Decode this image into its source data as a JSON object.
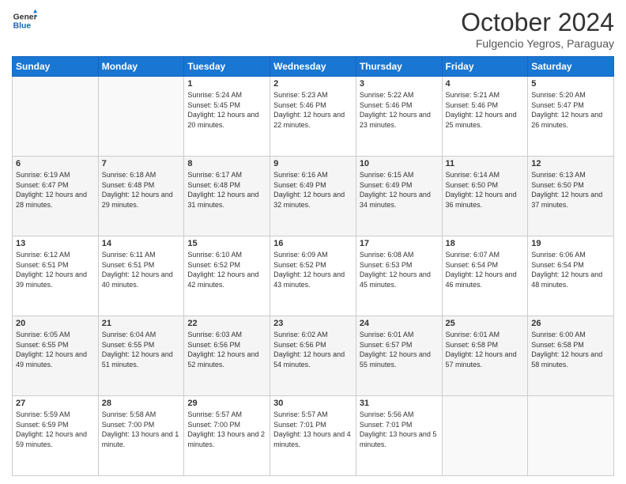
{
  "header": {
    "logo_line1": "General",
    "logo_line2": "Blue",
    "month_title": "October 2024",
    "location": "Fulgencio Yegros, Paraguay"
  },
  "days_of_week": [
    "Sunday",
    "Monday",
    "Tuesday",
    "Wednesday",
    "Thursday",
    "Friday",
    "Saturday"
  ],
  "weeks": [
    [
      {
        "day": "",
        "sunrise": "",
        "sunset": "",
        "daylight": ""
      },
      {
        "day": "",
        "sunrise": "",
        "sunset": "",
        "daylight": ""
      },
      {
        "day": "1",
        "sunrise": "Sunrise: 5:24 AM",
        "sunset": "Sunset: 5:45 PM",
        "daylight": "Daylight: 12 hours and 20 minutes."
      },
      {
        "day": "2",
        "sunrise": "Sunrise: 5:23 AM",
        "sunset": "Sunset: 5:46 PM",
        "daylight": "Daylight: 12 hours and 22 minutes."
      },
      {
        "day": "3",
        "sunrise": "Sunrise: 5:22 AM",
        "sunset": "Sunset: 5:46 PM",
        "daylight": "Daylight: 12 hours and 23 minutes."
      },
      {
        "day": "4",
        "sunrise": "Sunrise: 5:21 AM",
        "sunset": "Sunset: 5:46 PM",
        "daylight": "Daylight: 12 hours and 25 minutes."
      },
      {
        "day": "5",
        "sunrise": "Sunrise: 5:20 AM",
        "sunset": "Sunset: 5:47 PM",
        "daylight": "Daylight: 12 hours and 26 minutes."
      }
    ],
    [
      {
        "day": "6",
        "sunrise": "Sunrise: 6:19 AM",
        "sunset": "Sunset: 6:47 PM",
        "daylight": "Daylight: 12 hours and 28 minutes."
      },
      {
        "day": "7",
        "sunrise": "Sunrise: 6:18 AM",
        "sunset": "Sunset: 6:48 PM",
        "daylight": "Daylight: 12 hours and 29 minutes."
      },
      {
        "day": "8",
        "sunrise": "Sunrise: 6:17 AM",
        "sunset": "Sunset: 6:48 PM",
        "daylight": "Daylight: 12 hours and 31 minutes."
      },
      {
        "day": "9",
        "sunrise": "Sunrise: 6:16 AM",
        "sunset": "Sunset: 6:49 PM",
        "daylight": "Daylight: 12 hours and 32 minutes."
      },
      {
        "day": "10",
        "sunrise": "Sunrise: 6:15 AM",
        "sunset": "Sunset: 6:49 PM",
        "daylight": "Daylight: 12 hours and 34 minutes."
      },
      {
        "day": "11",
        "sunrise": "Sunrise: 6:14 AM",
        "sunset": "Sunset: 6:50 PM",
        "daylight": "Daylight: 12 hours and 36 minutes."
      },
      {
        "day": "12",
        "sunrise": "Sunrise: 6:13 AM",
        "sunset": "Sunset: 6:50 PM",
        "daylight": "Daylight: 12 hours and 37 minutes."
      }
    ],
    [
      {
        "day": "13",
        "sunrise": "Sunrise: 6:12 AM",
        "sunset": "Sunset: 6:51 PM",
        "daylight": "Daylight: 12 hours and 39 minutes."
      },
      {
        "day": "14",
        "sunrise": "Sunrise: 6:11 AM",
        "sunset": "Sunset: 6:51 PM",
        "daylight": "Daylight: 12 hours and 40 minutes."
      },
      {
        "day": "15",
        "sunrise": "Sunrise: 6:10 AM",
        "sunset": "Sunset: 6:52 PM",
        "daylight": "Daylight: 12 hours and 42 minutes."
      },
      {
        "day": "16",
        "sunrise": "Sunrise: 6:09 AM",
        "sunset": "Sunset: 6:52 PM",
        "daylight": "Daylight: 12 hours and 43 minutes."
      },
      {
        "day": "17",
        "sunrise": "Sunrise: 6:08 AM",
        "sunset": "Sunset: 6:53 PM",
        "daylight": "Daylight: 12 hours and 45 minutes."
      },
      {
        "day": "18",
        "sunrise": "Sunrise: 6:07 AM",
        "sunset": "Sunset: 6:54 PM",
        "daylight": "Daylight: 12 hours and 46 minutes."
      },
      {
        "day": "19",
        "sunrise": "Sunrise: 6:06 AM",
        "sunset": "Sunset: 6:54 PM",
        "daylight": "Daylight: 12 hours and 48 minutes."
      }
    ],
    [
      {
        "day": "20",
        "sunrise": "Sunrise: 6:05 AM",
        "sunset": "Sunset: 6:55 PM",
        "daylight": "Daylight: 12 hours and 49 minutes."
      },
      {
        "day": "21",
        "sunrise": "Sunrise: 6:04 AM",
        "sunset": "Sunset: 6:55 PM",
        "daylight": "Daylight: 12 hours and 51 minutes."
      },
      {
        "day": "22",
        "sunrise": "Sunrise: 6:03 AM",
        "sunset": "Sunset: 6:56 PM",
        "daylight": "Daylight: 12 hours and 52 minutes."
      },
      {
        "day": "23",
        "sunrise": "Sunrise: 6:02 AM",
        "sunset": "Sunset: 6:56 PM",
        "daylight": "Daylight: 12 hours and 54 minutes."
      },
      {
        "day": "24",
        "sunrise": "Sunrise: 6:01 AM",
        "sunset": "Sunset: 6:57 PM",
        "daylight": "Daylight: 12 hours and 55 minutes."
      },
      {
        "day": "25",
        "sunrise": "Sunrise: 6:01 AM",
        "sunset": "Sunset: 6:58 PM",
        "daylight": "Daylight: 12 hours and 57 minutes."
      },
      {
        "day": "26",
        "sunrise": "Sunrise: 6:00 AM",
        "sunset": "Sunset: 6:58 PM",
        "daylight": "Daylight: 12 hours and 58 minutes."
      }
    ],
    [
      {
        "day": "27",
        "sunrise": "Sunrise: 5:59 AM",
        "sunset": "Sunset: 6:59 PM",
        "daylight": "Daylight: 12 hours and 59 minutes."
      },
      {
        "day": "28",
        "sunrise": "Sunrise: 5:58 AM",
        "sunset": "Sunset: 7:00 PM",
        "daylight": "Daylight: 13 hours and 1 minute."
      },
      {
        "day": "29",
        "sunrise": "Sunrise: 5:57 AM",
        "sunset": "Sunset: 7:00 PM",
        "daylight": "Daylight: 13 hours and 2 minutes."
      },
      {
        "day": "30",
        "sunrise": "Sunrise: 5:57 AM",
        "sunset": "Sunset: 7:01 PM",
        "daylight": "Daylight: 13 hours and 4 minutes."
      },
      {
        "day": "31",
        "sunrise": "Sunrise: 5:56 AM",
        "sunset": "Sunset: 7:01 PM",
        "daylight": "Daylight: 13 hours and 5 minutes."
      },
      {
        "day": "",
        "sunrise": "",
        "sunset": "",
        "daylight": ""
      },
      {
        "day": "",
        "sunrise": "",
        "sunset": "",
        "daylight": ""
      }
    ]
  ]
}
